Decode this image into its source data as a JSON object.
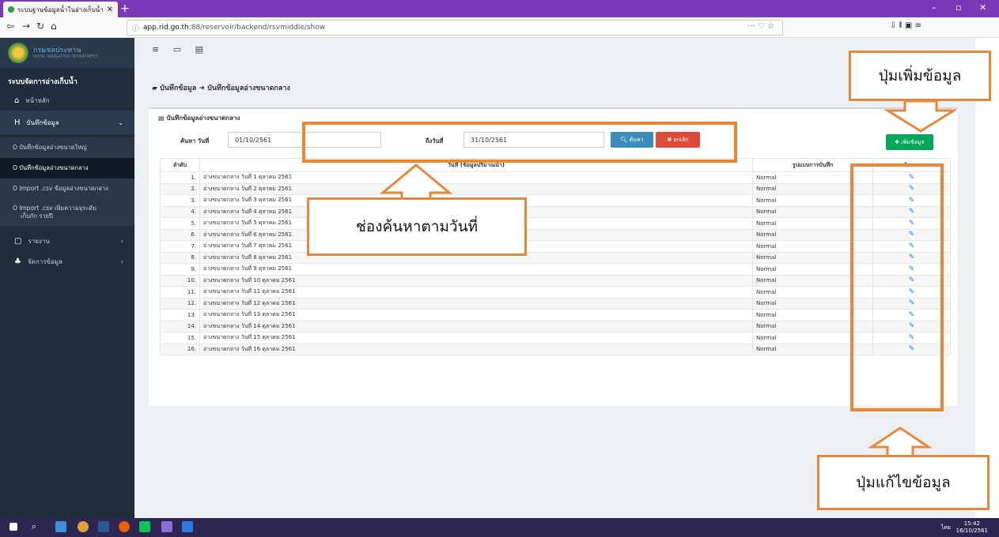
{
  "browser": {
    "tab_title": "ระบบฐานข้อมูลน้ำในอ่างเก็บน้ำ ศร",
    "tab_close": "✕",
    "new_tab": "+",
    "url_host": "app.rid.go.th",
    "url_path": ":88/reservoir/backend/rsvmiddle/show",
    "url_actions": "··· ♡ ☆",
    "toolbar_right": "⇩  ⫴  ▣  ≡"
  },
  "sidebar": {
    "org_name": "กรมชลประทาน",
    "org_sub": "ROYAL IRRIGATION DEPARTMENT",
    "heading": "ระบบจัดการอ่างเก็บน้ำ",
    "home": "หน้าหลัก",
    "record": "บันทึกข้อมูล",
    "sub_items": [
      "O บันทึกข้อมูลอ่างขนาดใหญ่",
      "O บันทึกข้อมูลอ่างขนาดกลาง",
      "O Import .csv ข้อมูลอ่างขนาดกลาง",
      "O Import .csv เพิ่มความจุระดับ",
      "เก็บกัก รายปี"
    ],
    "report": "รายงาน",
    "manage": "จัดการข้อมูล"
  },
  "main": {
    "breadcrumb": "บันทึกข้อมูล ➜ บันทึกข้อมูลอ่างขนาดกลาง",
    "panel_title": "บันทึกข้อมูลอ่างขนาดกลาง",
    "search_label": "ค้นหา วันที่",
    "search_from": "01/10/2561",
    "to_label": "ถึงวันที่",
    "search_to": "31/10/2561",
    "search_button": "ค้นหา",
    "cancel_button": "ยกเลิก",
    "add_button": "เพิ่มข้อมูล",
    "table": {
      "headers": [
        "ลำดับ",
        "วันที่ (ข้อมูลปริมาณน้ำ)",
        "รูปแบบการบันทึก",
        "จัดการ"
      ],
      "rows": [
        [
          "1.",
          "อ่างขนาดกลาง วันที่ 1 ตุลาคม 2561",
          "Normal"
        ],
        [
          "2.",
          "อ่างขนาดกลาง วันที่ 2 ตุลาคม 2561",
          "Normal"
        ],
        [
          "3.",
          "อ่างขนาดกลาง วันที่ 3 ตุลาคม 2561",
          "Normal"
        ],
        [
          "4.",
          "อ่างขนาดกลาง วันที่ 4 ตุลาคม 2561",
          "Normal"
        ],
        [
          "5.",
          "อ่างขนาดกลาง วันที่ 5 ตุลาคม 2561",
          "Normal"
        ],
        [
          "6.",
          "อ่างขนาดกลาง วันที่ 6 ตุลาคม 2561",
          "Normal"
        ],
        [
          "7.",
          "อ่างขนาดกลาง วันที่ 7 ตุลาคม 2561",
          "Normal"
        ],
        [
          "8.",
          "อ่างขนาดกลาง วันที่ 8 ตุลาคม 2561",
          "Normal"
        ],
        [
          "9.",
          "อ่างขนาดกลาง วันที่ 9 ตุลาคม 2561",
          "Normal"
        ],
        [
          "10.",
          "อ่างขนาดกลาง วันที่ 10 ตุลาคม 2561",
          "Normal"
        ],
        [
          "11.",
          "อ่างขนาดกลาง วันที่ 11 ตุลาคม 2561",
          "Normal"
        ],
        [
          "12.",
          "อ่างขนาดกลาง วันที่ 12 ตุลาคม 2561",
          "Normal"
        ],
        [
          "13.",
          "อ่างขนาดกลาง วันที่ 13 ตุลาคม 2561",
          "Normal"
        ],
        [
          "14.",
          "อ่างขนาดกลาง วันที่ 14 ตุลาคม 2561",
          "Normal"
        ],
        [
          "15.",
          "อ่างขนาดกลาง วันที่ 15 ตุลาคม 2561",
          "Normal"
        ],
        [
          "16.",
          "อ่างขนาดกลาง วันที่ 16 ตุลาคม 2561",
          "Normal"
        ]
      ]
    }
  },
  "annotations": {
    "add_data": "ปุ่มเพิ่มข้อมูล",
    "search_date": "ช่องค้นหาตามวันที่",
    "edit_data": "ปุ่มแก้ไขข้อมูล"
  },
  "taskbar": {
    "time": "15:42",
    "date": "16/10/2561",
    "lang": "ไทย"
  },
  "colors": {
    "accent_orange": "#e8873a",
    "search_blue": "#3c8dbc",
    "cancel_red": "#dd4b39",
    "add_green": "#00a65a",
    "sidebar_dark": "#1f2d3d"
  }
}
